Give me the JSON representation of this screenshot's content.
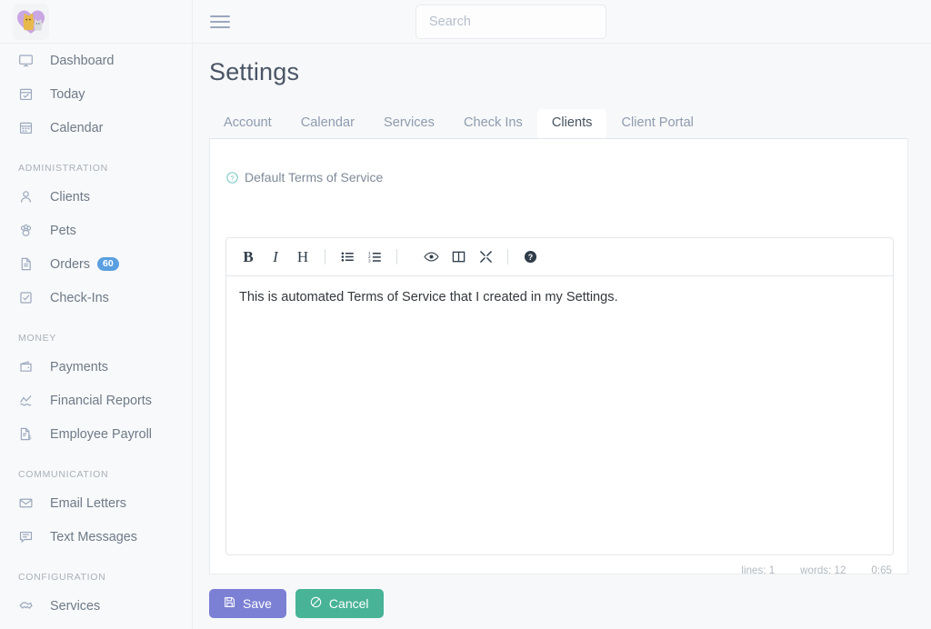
{
  "app": {
    "logo_icon": "dog-cat-heart-logo",
    "menu_icon": "hamburger-menu-icon"
  },
  "search": {
    "placeholder": "Search",
    "value": "",
    "icon": "search-icon"
  },
  "sidebar": {
    "groups": [
      {
        "label": "",
        "items": [
          {
            "label": "Dashboard",
            "icon": "monitor-icon",
            "badge": ""
          },
          {
            "label": "Today",
            "icon": "calendar-check-icon",
            "badge": ""
          },
          {
            "label": "Calendar",
            "icon": "calendar-icon",
            "badge": ""
          }
        ]
      },
      {
        "label": "ADMINISTRATION",
        "items": [
          {
            "label": "Clients",
            "icon": "user-icon",
            "badge": ""
          },
          {
            "label": "Pets",
            "icon": "paw-icon",
            "badge": ""
          },
          {
            "label": "Orders",
            "icon": "document-icon",
            "badge": "60"
          },
          {
            "label": "Check-Ins",
            "icon": "checkbox-icon",
            "badge": ""
          }
        ]
      },
      {
        "label": "MONEY",
        "items": [
          {
            "label": "Payments",
            "icon": "wallet-icon",
            "badge": ""
          },
          {
            "label": "Financial Reports",
            "icon": "chart-line-icon",
            "badge": ""
          },
          {
            "label": "Employee Payroll",
            "icon": "document-dollar-icon",
            "badge": ""
          }
        ]
      },
      {
        "label": "COMMUNICATION",
        "items": [
          {
            "label": "Email Letters",
            "icon": "envelope-icon",
            "badge": ""
          },
          {
            "label": "Text Messages",
            "icon": "message-icon",
            "badge": ""
          }
        ]
      },
      {
        "label": "CONFIGURATION",
        "items": [
          {
            "label": "Services",
            "icon": "handshake-icon",
            "badge": ""
          }
        ]
      }
    ]
  },
  "main": {
    "title": "Settings",
    "tabs": [
      {
        "label": "Account",
        "active": false
      },
      {
        "label": "Calendar",
        "active": false
      },
      {
        "label": "Services",
        "active": false
      },
      {
        "label": "Check Ins",
        "active": false
      },
      {
        "label": "Clients",
        "active": true
      },
      {
        "label": "Client Portal",
        "active": false
      }
    ],
    "annotation": {
      "shape": "ellipse",
      "color": "#5cb24a",
      "target_tab": "Clients"
    },
    "field": {
      "label": "Default Terms of Service",
      "help_icon": "question-circle-icon"
    },
    "editor": {
      "content": "This is automated Terms of Service that I created in my Settings.",
      "toolbar": [
        {
          "name": "bold-button",
          "glyph": "B"
        },
        {
          "name": "italic-button",
          "glyph": "I"
        },
        {
          "name": "heading-button",
          "glyph": "H"
        },
        {
          "name": "unordered-list-button",
          "glyph": ""
        },
        {
          "name": "ordered-list-button",
          "glyph": ""
        },
        {
          "name": "preview-button",
          "glyph": ""
        },
        {
          "name": "side-by-side-button",
          "glyph": ""
        },
        {
          "name": "fullscreen-button",
          "glyph": ""
        },
        {
          "name": "help-button",
          "glyph": ""
        }
      ],
      "status": {
        "lines": "lines: 1",
        "words": "words: 12",
        "cursor": "0:65"
      }
    },
    "buttons": {
      "save": "Save",
      "cancel": "Cancel",
      "save_icon": "floppy-disk-icon",
      "cancel_icon": "ban-icon"
    }
  },
  "colors": {
    "save": "#7b80d4",
    "cancel": "#48b396",
    "badge": "#5a9fe0",
    "annotation": "#5cb24a"
  }
}
